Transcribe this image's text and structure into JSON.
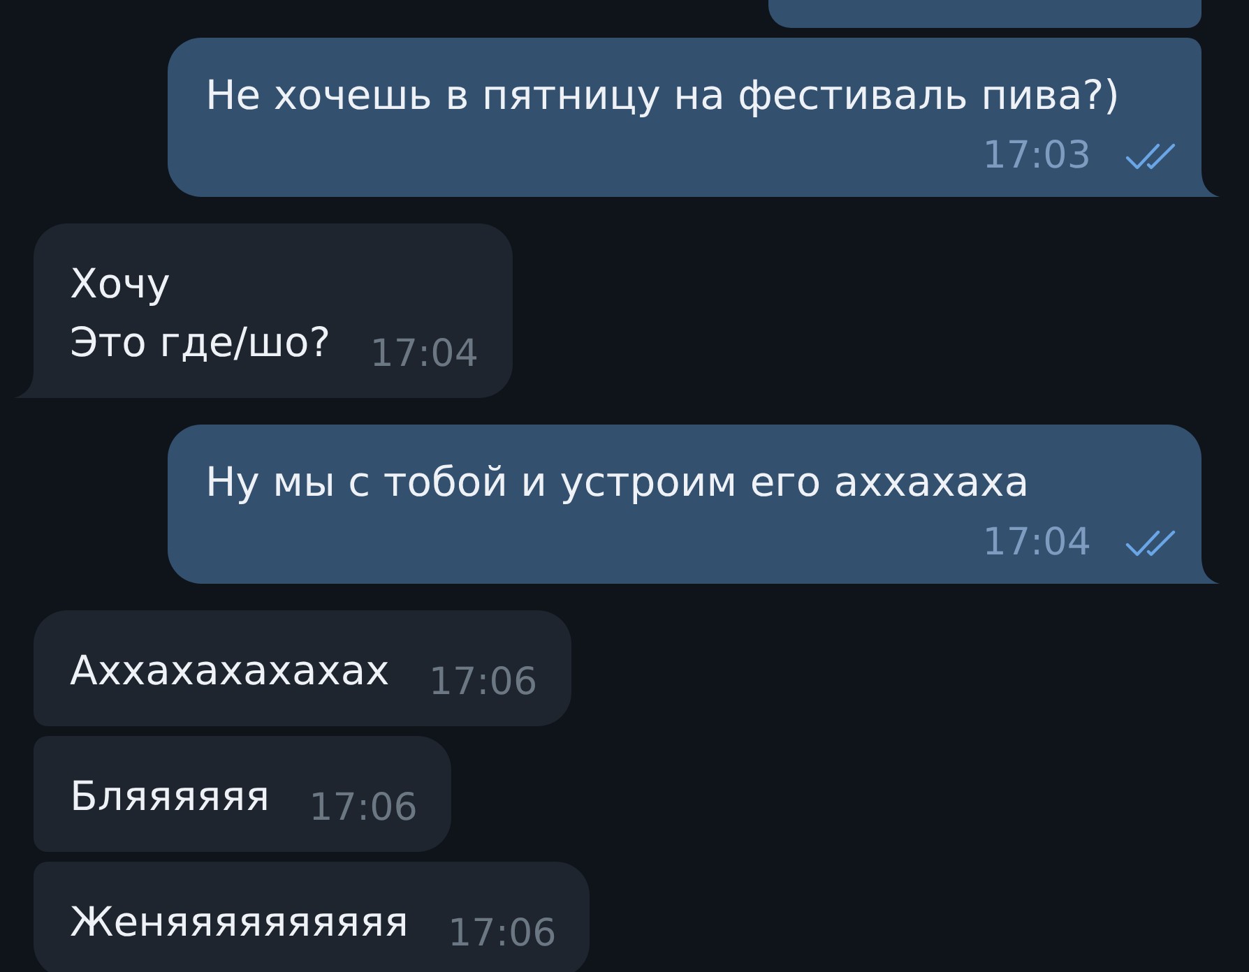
{
  "messages": [
    {
      "kind": "partial",
      "outgoing": true,
      "tail": false
    },
    {
      "kind": "text",
      "outgoing": true,
      "text": "Не хочешь в пятницу на фестиваль пива?)",
      "time": "17:03",
      "read": true,
      "tail": true
    },
    {
      "kind": "text",
      "outgoing": false,
      "text": "Хочу\nЭто где/шо?",
      "time": "17:04",
      "tail": true
    },
    {
      "kind": "text",
      "outgoing": true,
      "text": "Ну мы с тобой и устроим его аххахаха",
      "time": "17:04",
      "read": true,
      "tail": true
    },
    {
      "kind": "text",
      "outgoing": false,
      "text": "Аххахахахахах",
      "time": "17:06",
      "tail": false
    },
    {
      "kind": "text",
      "outgoing": false,
      "text": "Бляяяяяя",
      "time": "17:06",
      "tail": false
    },
    {
      "kind": "text",
      "outgoing": false,
      "text": "Женяяяяяяяяяя",
      "time": "17:06",
      "tail": false
    }
  ]
}
